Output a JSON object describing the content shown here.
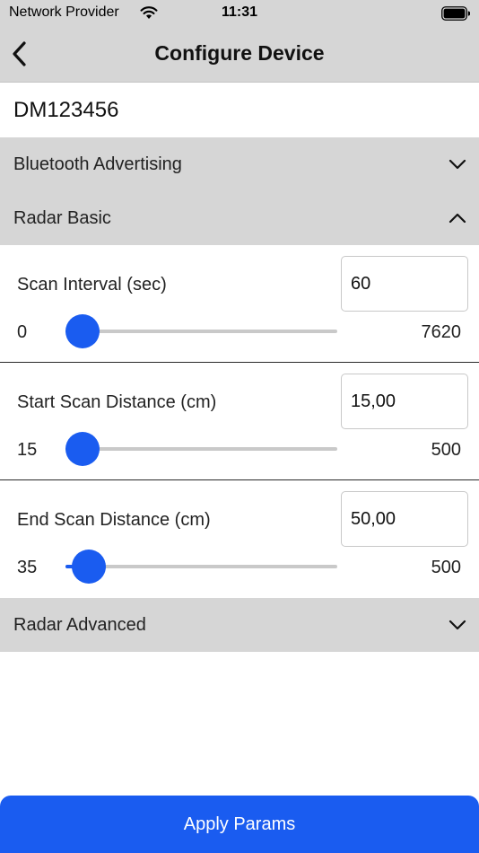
{
  "status_bar": {
    "carrier": "Network Provider",
    "time": "11:31",
    "wifi_icon": "wifi-icon",
    "battery_icon": "battery-full-icon"
  },
  "header": {
    "title": "Configure Device",
    "back_icon": "chevron-left-icon"
  },
  "device": {
    "id": "DM123456"
  },
  "sections": {
    "bluetooth": {
      "label": "Bluetooth Advertising",
      "expanded": false
    },
    "radar_basic": {
      "label": "Radar Basic",
      "expanded": true
    },
    "radar_advanced": {
      "label": "Radar Advanced",
      "expanded": false
    }
  },
  "params": [
    {
      "label": "Scan Interval (sec)",
      "value": "60",
      "min": "0",
      "max": "7620",
      "slider_fraction": 0.06
    },
    {
      "label": "Start Scan Distance (cm)",
      "value": "15,00",
      "min": "15",
      "max": "500",
      "slider_fraction": 0.06
    },
    {
      "label": "End Scan Distance (cm)",
      "value": "50,00",
      "min": "35",
      "max": "500",
      "slider_fraction": 0.085
    }
  ],
  "footer": {
    "apply_label": "Apply Params"
  },
  "colors": {
    "accent": "#1a5cf0",
    "header_bg": "#d6d6d6"
  }
}
